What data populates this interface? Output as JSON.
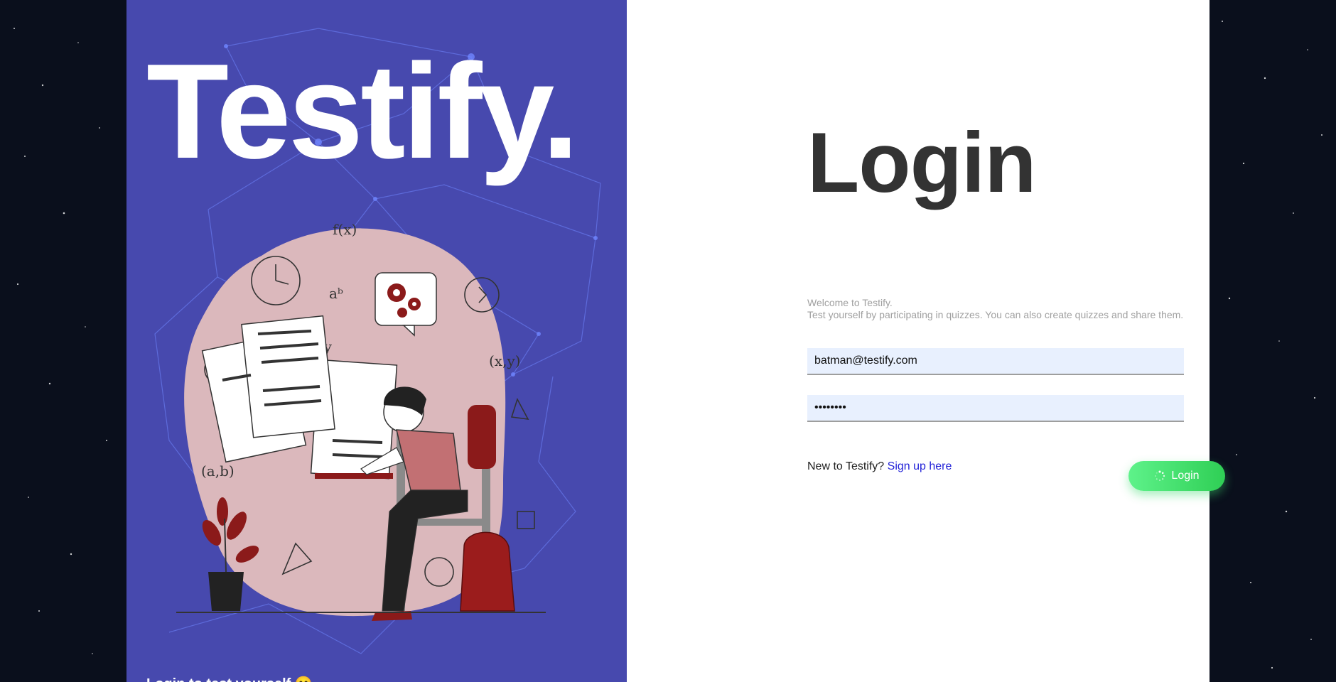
{
  "brand": {
    "title": "Testify.",
    "tagline": "Login to test yourself 😊"
  },
  "login": {
    "title": "Login",
    "welcome_line1": "Welcome to Testify.",
    "welcome_line2": "Test yourself by participating in quizzes. You can also create quizzes and share them.",
    "email_value": "batman@testify.com",
    "password_value": "password",
    "signup_prompt": "New to Testify?",
    "signup_link": "Sign up here",
    "button_label": "Login"
  },
  "colors": {
    "panel": "#4749ae",
    "accent_green": "#38d463",
    "link": "#2323d8",
    "blob": "#dbb8bc"
  },
  "icons": {
    "button": "spinner-icon"
  }
}
